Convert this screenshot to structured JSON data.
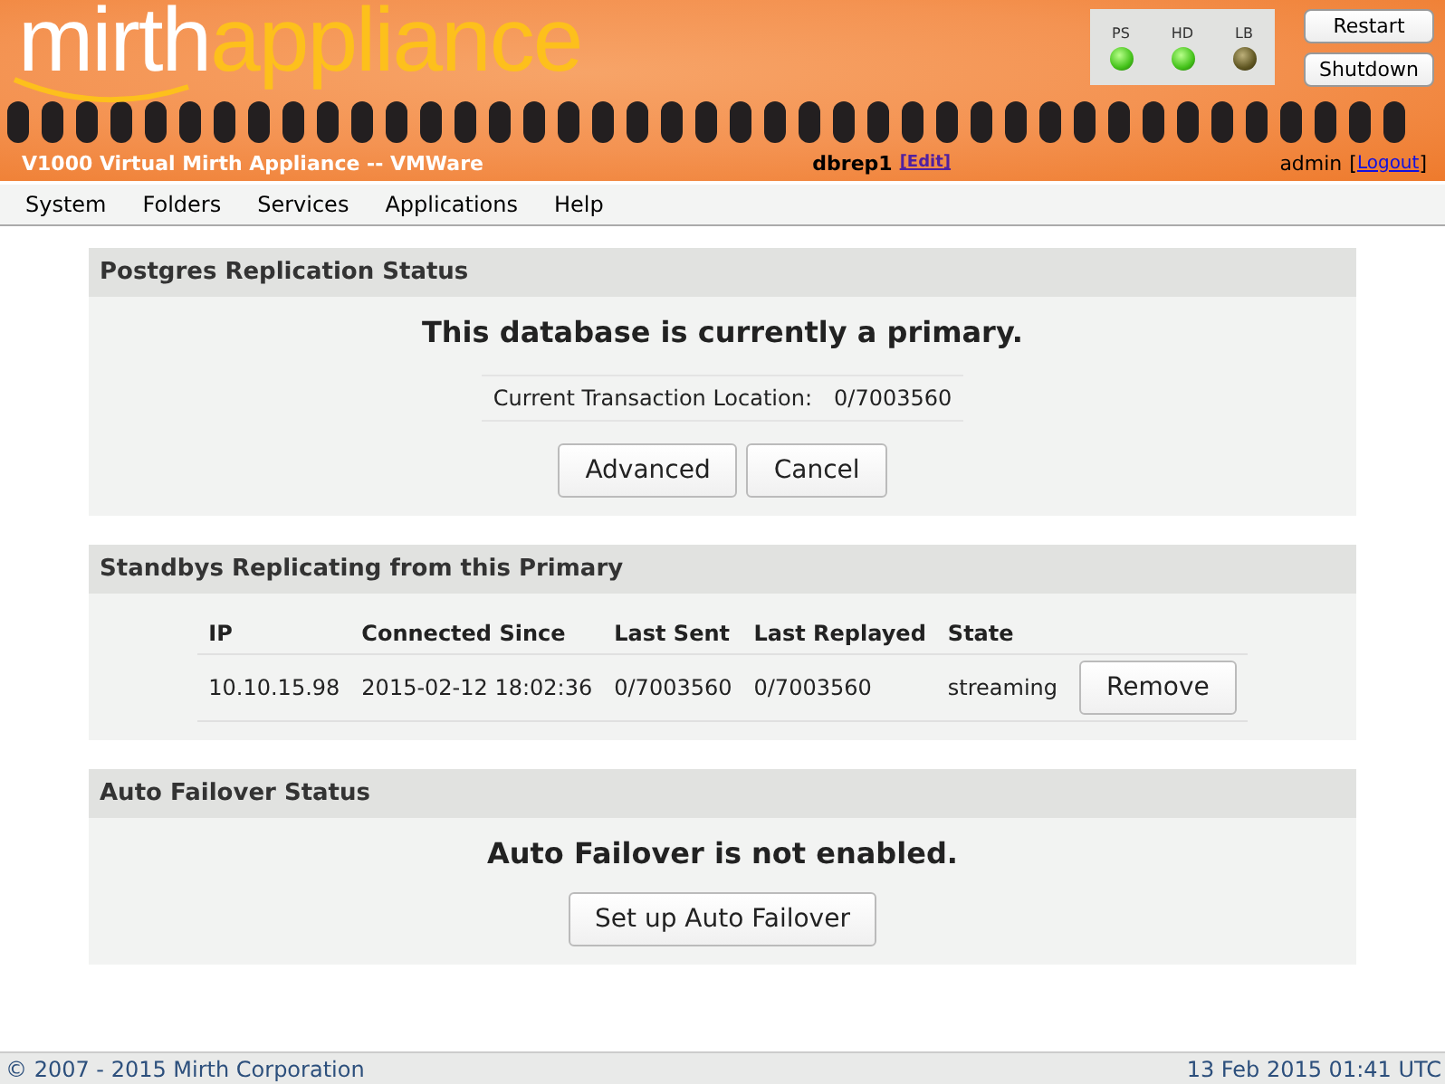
{
  "header": {
    "logo_left": "mirth",
    "logo_right": "appliance",
    "subtitle": "V1000 Virtual Mirth Appliance -- VMWare",
    "hostname": "dbrep1",
    "edit_link": "[Edit]",
    "user": "admin",
    "logout_prefix": "[",
    "logout_link": "Logout",
    "logout_suffix": "]",
    "lights": [
      {
        "label": "PS",
        "on": true
      },
      {
        "label": "HD",
        "on": true
      },
      {
        "label": "LB",
        "on": false
      }
    ],
    "buttons": [
      "Restart",
      "Shutdown"
    ]
  },
  "menu": [
    "System",
    "Folders",
    "Services",
    "Applications",
    "Help"
  ],
  "replication": {
    "title": "Postgres Replication Status",
    "message": "This database is currently a primary.",
    "location_label": "Current Transaction Location:",
    "location_value": "0/7003560",
    "buttons": [
      "Advanced",
      "Cancel"
    ]
  },
  "standbys": {
    "title": "Standbys Replicating from this Primary",
    "columns": [
      "IP",
      "Connected Since",
      "Last Sent",
      "Last Replayed",
      "State"
    ],
    "rows": [
      {
        "cells": [
          "10.10.15.98",
          "2015-02-12 18:02:36",
          "0/7003560",
          "0/7003560",
          "streaming"
        ],
        "action": "Remove"
      }
    ]
  },
  "failover": {
    "title": "Auto Failover Status",
    "message": "Auto Failover is not enabled.",
    "button": "Set up Auto Failover"
  },
  "footer": {
    "copyright": "© 2007 - 2015 Mirth Corporation",
    "timestamp": "13 Feb 2015 01:41 UTC"
  }
}
